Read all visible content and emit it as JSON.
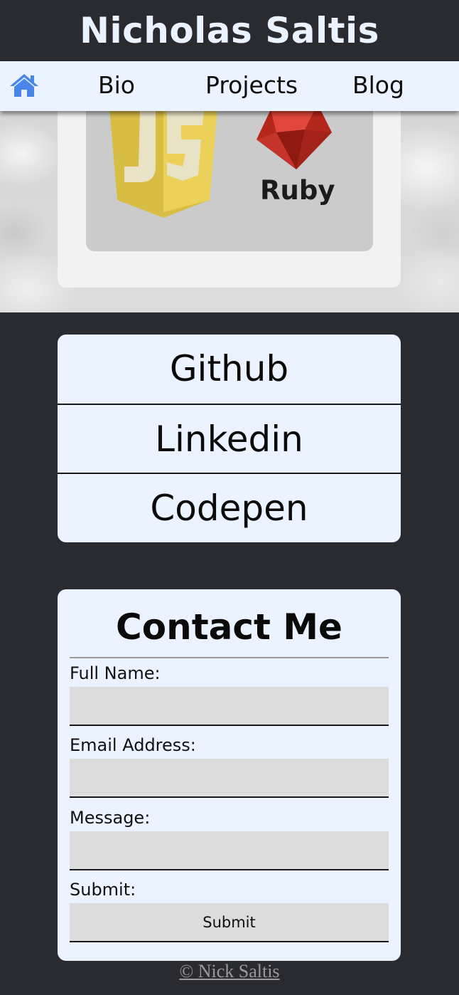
{
  "header": {
    "title": "Nicholas Saltis"
  },
  "nav": {
    "home_icon": "home-icon",
    "items": [
      {
        "label": "Bio"
      },
      {
        "label": "Projects"
      },
      {
        "label": "Blog"
      }
    ]
  },
  "skills": {
    "logos": [
      "javascript-logo",
      "ruby-logo"
    ],
    "ruby_label": "Ruby"
  },
  "links": [
    {
      "label": "Github"
    },
    {
      "label": "Linkedin"
    },
    {
      "label": "Codepen"
    }
  ],
  "contact": {
    "title": "Contact Me",
    "full_name_label": "Full Name:",
    "full_name_value": "",
    "email_label": "Email Address:",
    "email_value": "",
    "message_label": "Message:",
    "message_value": "",
    "submit_label": "Submit:",
    "submit_button": "Submit"
  },
  "footer": {
    "text": "© Nick Saltis"
  },
  "colors": {
    "background": "#2a2b30",
    "panel": "#eaf3ff",
    "home_icon": "#4a86e8",
    "input": "#dcdcdc"
  }
}
